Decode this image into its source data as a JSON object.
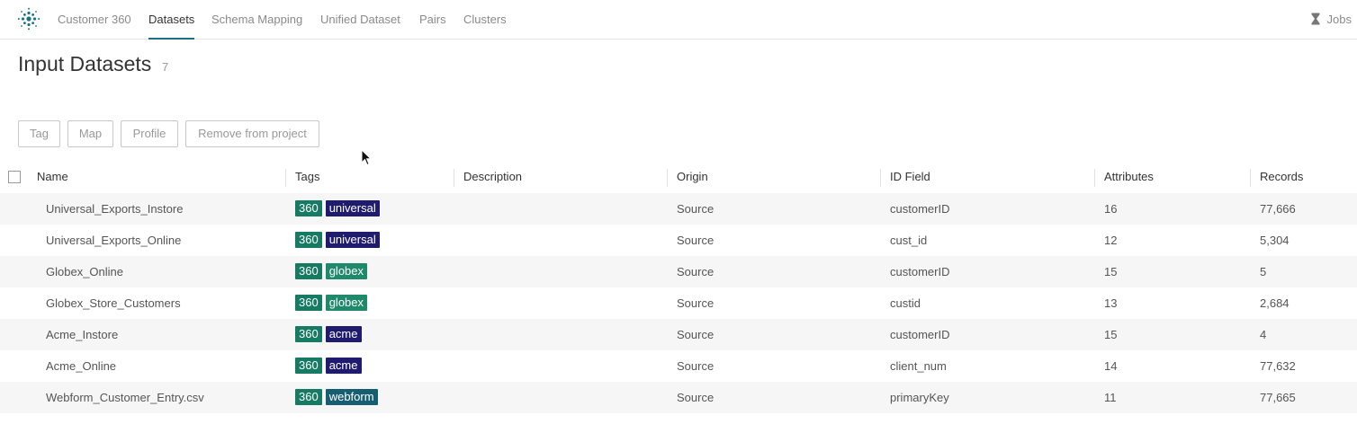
{
  "nav": {
    "tabs": [
      {
        "label": "Customer 360",
        "active": false
      },
      {
        "label": "Datasets",
        "active": true
      },
      {
        "label": "Schema Mapping",
        "active": false
      },
      {
        "label": "Unified Dataset",
        "active": false
      },
      {
        "label": "Pairs",
        "active": false
      },
      {
        "label": "Clusters",
        "active": false
      }
    ],
    "jobs_label": "Jobs",
    "accent_color": "#1b6f87"
  },
  "header": {
    "title": "Input Datasets",
    "count": "7"
  },
  "actions": {
    "tag_label": "Tag",
    "map_label": "Map",
    "profile_label": "Profile",
    "remove_label": "Remove from project"
  },
  "table": {
    "columns": {
      "name": "Name",
      "tags": "Tags",
      "description": "Description",
      "origin": "Origin",
      "id_field": "ID Field",
      "attributes": "Attributes",
      "records": "Records"
    },
    "tag_colors": {
      "360": "#177a62",
      "universal": "#1f1b6e",
      "globex": "#1f8a6b",
      "acme": "#1f1b6e",
      "webform": "#185e73"
    },
    "rows": [
      {
        "name": "Universal_Exports_Instore",
        "tags": [
          "360",
          "universal"
        ],
        "description": "",
        "origin": "Source",
        "id_field": "customerID",
        "attributes": "16",
        "records": "77,666"
      },
      {
        "name": "Universal_Exports_Online",
        "tags": [
          "360",
          "universal"
        ],
        "description": "",
        "origin": "Source",
        "id_field": "cust_id",
        "attributes": "12",
        "records": "5,304"
      },
      {
        "name": "Globex_Online",
        "tags": [
          "360",
          "globex"
        ],
        "description": "",
        "origin": "Source",
        "id_field": "customerID",
        "attributes": "15",
        "records": "5"
      },
      {
        "name": "Globex_Store_Customers",
        "tags": [
          "360",
          "globex"
        ],
        "description": "",
        "origin": "Source",
        "id_field": "custid",
        "attributes": "13",
        "records": "2,684"
      },
      {
        "name": "Acme_Instore",
        "tags": [
          "360",
          "acme"
        ],
        "description": "",
        "origin": "Source",
        "id_field": "customerID",
        "attributes": "15",
        "records": "4"
      },
      {
        "name": "Acme_Online",
        "tags": [
          "360",
          "acme"
        ],
        "description": "",
        "origin": "Source",
        "id_field": "client_num",
        "attributes": "14",
        "records": "77,632"
      },
      {
        "name": "Webform_Customer_Entry.csv",
        "tags": [
          "360",
          "webform"
        ],
        "description": "",
        "origin": "Source",
        "id_field": "primaryKey",
        "attributes": "11",
        "records": "77,665"
      }
    ]
  }
}
